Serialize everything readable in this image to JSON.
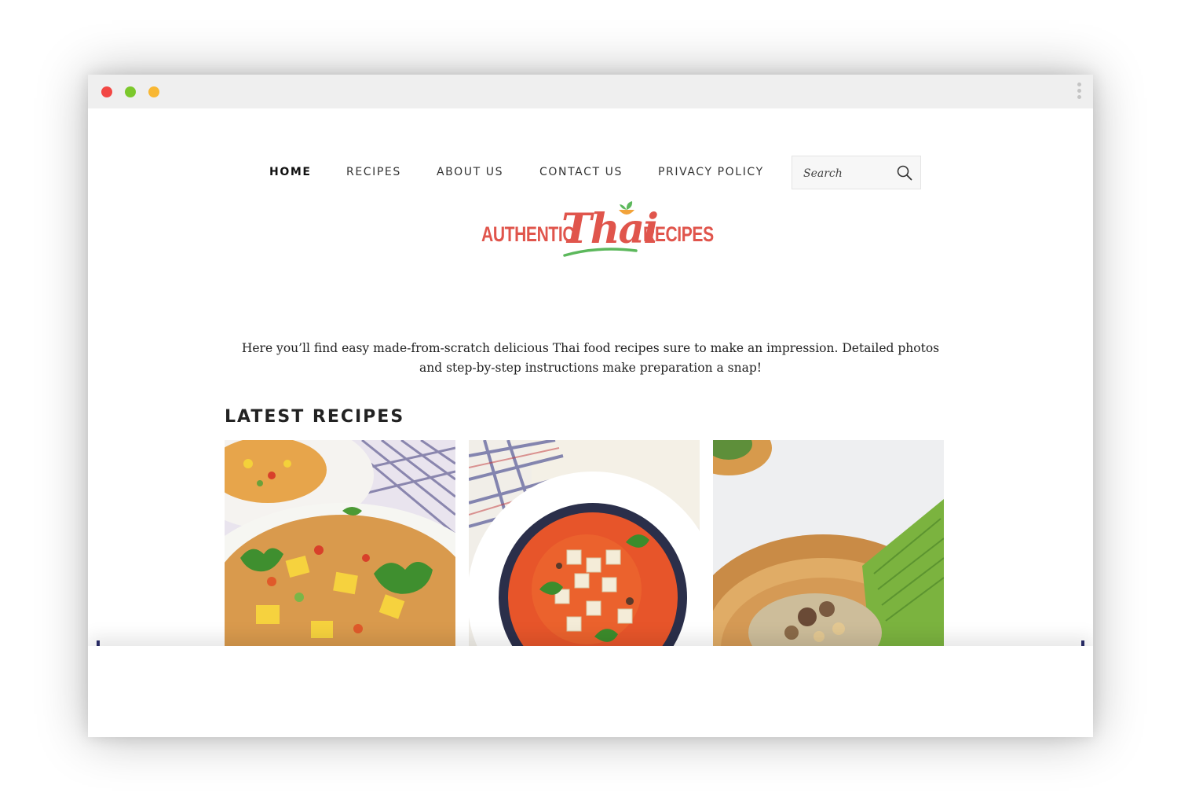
{
  "browser": {
    "controls": [
      "close",
      "minimize",
      "zoom"
    ]
  },
  "nav": {
    "items": [
      {
        "label": "HOME"
      },
      {
        "label": "RECIPES"
      },
      {
        "label": "ABOUT US"
      },
      {
        "label": "CONTACT US"
      },
      {
        "label": "PRIVACY POLICY"
      }
    ],
    "search_placeholder": "Search"
  },
  "logo": {
    "left_text": "AUTHENTIC",
    "script_text": "Thai",
    "right_text": "RECIPES",
    "color": "#e0554c",
    "accent_color": "#5cb85c"
  },
  "intro": {
    "text": "Here you’ll find easy made-from-scratch delicious Thai food recipes sure to make an impression. Detailed photos and step-by-step instructions make preparation a snap!"
  },
  "latest": {
    "heading": "LATEST RECIPES",
    "cards": [
      {
        "image": "pineapple-fried-rice-photo"
      },
      {
        "image": "red-curry-tofu-photo"
      },
      {
        "image": "sticky-rice-banana-leaf-photo"
      }
    ]
  }
}
